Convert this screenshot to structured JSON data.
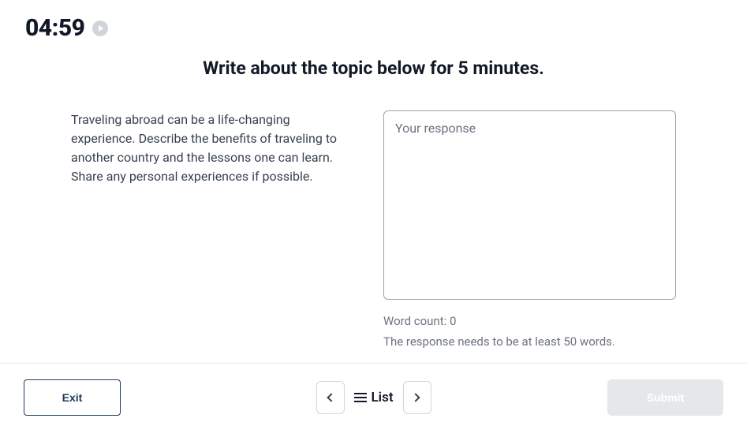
{
  "timer": {
    "value": "04:59"
  },
  "heading": "Write about the topic below for 5 minutes.",
  "prompt": "Traveling abroad can be a life-changing experience. Describe the benefits of traveling to another country and the lessons one can learn. Share any personal experiences if possible.",
  "response": {
    "placeholder": "Your response",
    "value": ""
  },
  "wordCount": {
    "label": "Word count: ",
    "value": "0"
  },
  "wordNote": "The response needs to be at least 50 words.",
  "footer": {
    "exit": "Exit",
    "list": "List",
    "submit": "Submit"
  }
}
